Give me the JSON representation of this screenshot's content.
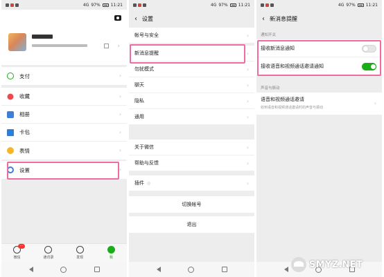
{
  "status": {
    "signal": "4G",
    "battery": "97%",
    "time": "11:21"
  },
  "screen1": {
    "payment": "支付",
    "favorites": "收藏",
    "album": "相册",
    "wallet": "卡包",
    "emoji": "表情",
    "settings": "设置",
    "tabs": [
      {
        "label": "微信",
        "badge": "···"
      },
      {
        "label": "通讯录"
      },
      {
        "label": "发现"
      },
      {
        "label": "我"
      }
    ]
  },
  "screen2": {
    "title": "设置",
    "items": [
      "帐号与安全",
      "新消息提醒",
      "勿扰模式",
      "聊天",
      "隐私",
      "通用",
      "关于微信",
      "帮助与反馈",
      "插件"
    ],
    "switch_account": "切换帐号",
    "logout": "退出"
  },
  "screen3": {
    "title": "新消息提醒",
    "section_notify": "通知开关",
    "receive_new_msg": "接收新消息通知",
    "receive_new_msg_on": false,
    "receive_call": "接收语音和视频通话邀请通知",
    "receive_call_on": true,
    "section_sound": "声音与振动",
    "call_invite": "语音和视频通话邀请",
    "call_invite_desc": "收到语音和视频通话邀请时的声音与振动"
  },
  "highlight_color": "#f06ca0",
  "watermark": {
    "text": "SMYZ.NET"
  }
}
